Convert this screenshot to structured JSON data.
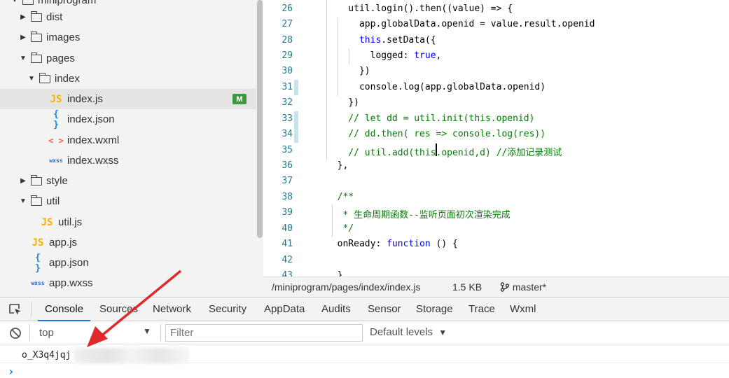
{
  "sidebar": {
    "items": [
      {
        "label": "miniprogram",
        "type": "folder"
      },
      {
        "label": "dist",
        "type": "folder"
      },
      {
        "label": "images",
        "type": "folder"
      },
      {
        "label": "pages",
        "type": "folder"
      },
      {
        "label": "index",
        "type": "folder"
      },
      {
        "label": "index.js",
        "icon": "JS",
        "badge": "M"
      },
      {
        "label": "index.json",
        "icon": "{ }"
      },
      {
        "label": "index.wxml",
        "icon": "< >"
      },
      {
        "label": "index.wxss",
        "icon": "wxss"
      },
      {
        "label": "style",
        "type": "folder"
      },
      {
        "label": "util",
        "type": "folder"
      },
      {
        "label": "util.js",
        "icon": "JS"
      },
      {
        "label": "app.js",
        "icon": "JS"
      },
      {
        "label": "app.json",
        "icon": "{ }"
      },
      {
        "label": "app.wxss",
        "icon": "wxss"
      }
    ]
  },
  "editor": {
    "line_numbers": [
      "26",
      "27",
      "28",
      "29",
      "30",
      "31",
      "32",
      "33",
      "34",
      "35",
      "36",
      "37",
      "38",
      "39",
      "40",
      "41",
      "42",
      "43"
    ]
  },
  "status": {
    "path": "/miniprogram/pages/index/index.js",
    "size": "1.5 KB",
    "branch": "master*"
  },
  "devtools": {
    "tabs": [
      "Console",
      "Sources",
      "Network",
      "Security",
      "AppData",
      "Audits",
      "Sensor",
      "Storage",
      "Trace",
      "Wxml"
    ],
    "context": "top",
    "filter_placeholder": "Filter",
    "levels": "Default levels",
    "output": "o_X3q4jqj",
    "prompt": "›"
  },
  "colors": {
    "accent": "#1a73e8",
    "modified_badge": "#3c9a3c",
    "annotation_arrow": "#e0292b"
  }
}
